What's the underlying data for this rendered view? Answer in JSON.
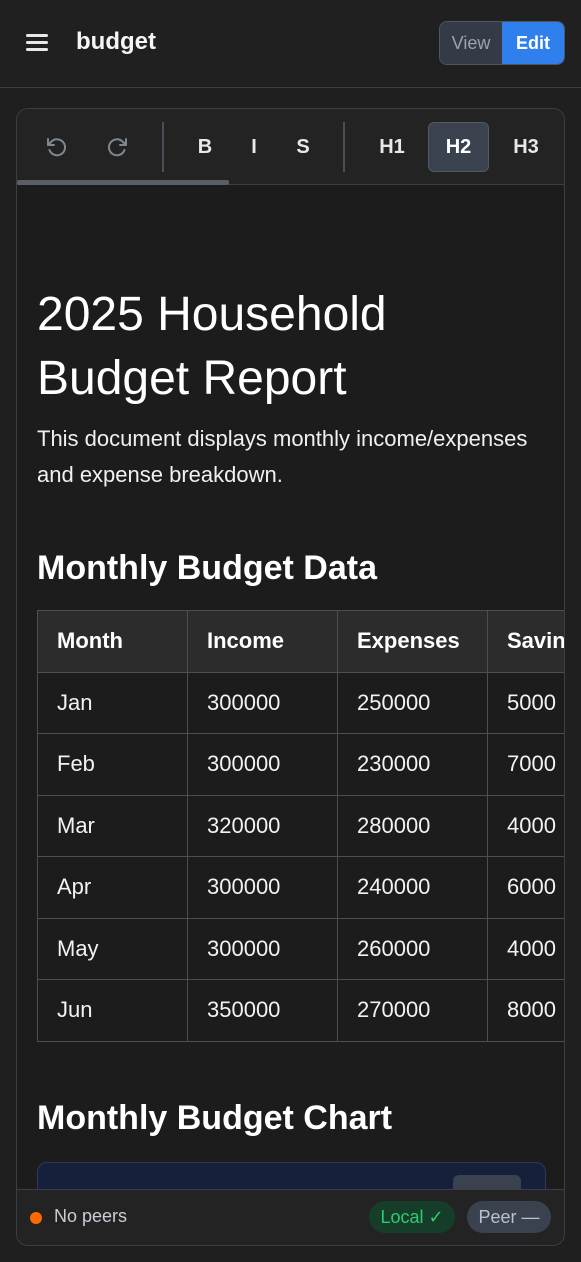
{
  "header": {
    "title": "budget",
    "mode_toggle": {
      "view_label": "View",
      "edit_label": "Edit",
      "active": "Edit"
    }
  },
  "toolbar": {
    "undo_icon": "undo-icon",
    "redo_icon": "redo-icon",
    "bold_label": "B",
    "italic_label": "I",
    "strike_label": "S",
    "h1_label": "H1",
    "h2_label": "H2",
    "h3_label": "H3",
    "active_heading": "H2"
  },
  "document": {
    "title": "2025 Household Budget Report",
    "intro": "This document displays monthly income/expenses and expense breakdown.",
    "section_data_heading": "Monthly Budget Data",
    "section_chart_heading": "Monthly Budget Chart",
    "table": {
      "headers": [
        "Month",
        "Income",
        "Expenses",
        "Savin"
      ],
      "rows": [
        [
          "Jan",
          "300000",
          "250000",
          "5000"
        ],
        [
          "Feb",
          "300000",
          "230000",
          "7000"
        ],
        [
          "Mar",
          "320000",
          "280000",
          "4000"
        ],
        [
          "Apr",
          "300000",
          "240000",
          "6000"
        ],
        [
          "May",
          "300000",
          "260000",
          "4000"
        ],
        [
          "Jun",
          "350000",
          "270000",
          "8000"
        ]
      ]
    }
  },
  "status": {
    "peers_text": "No peers",
    "peer_dot_color": "#ff6a00",
    "local_badge": "Local ✓",
    "peer_badge": "Peer —"
  },
  "colors": {
    "accent": "#2f80ed",
    "local_ok": "#2ecc71"
  }
}
